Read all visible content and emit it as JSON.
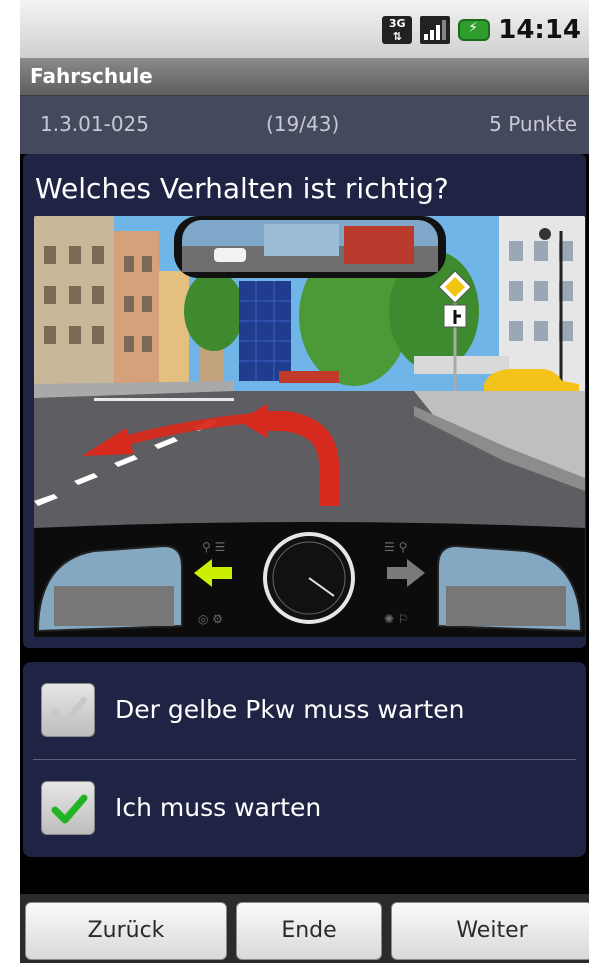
{
  "status_bar": {
    "network_label": "3G",
    "time": "14:14",
    "icons": [
      "3g-data-icon",
      "signal-strength-icon",
      "battery-charging-icon"
    ]
  },
  "app": {
    "title": "Fahrschule"
  },
  "question_info": {
    "code": "1.3.01-025",
    "progress": "(19/43)",
    "points": "5 Punkte"
  },
  "question": {
    "text": "Welches Verhalten ist richtig?"
  },
  "answers": [
    {
      "label": "Der gelbe Pkw muss warten",
      "checked": true,
      "check_color": "#c8c8c8"
    },
    {
      "label": "Ich muss warten",
      "checked": true,
      "check_color": "#22b322"
    }
  ],
  "buttons": {
    "back": "Zurück",
    "end": "Ende",
    "next": "Weiter"
  },
  "colors": {
    "card_background": "#1f2444",
    "info_strip": "#44495e",
    "route_arrow": "#d62a1e"
  }
}
